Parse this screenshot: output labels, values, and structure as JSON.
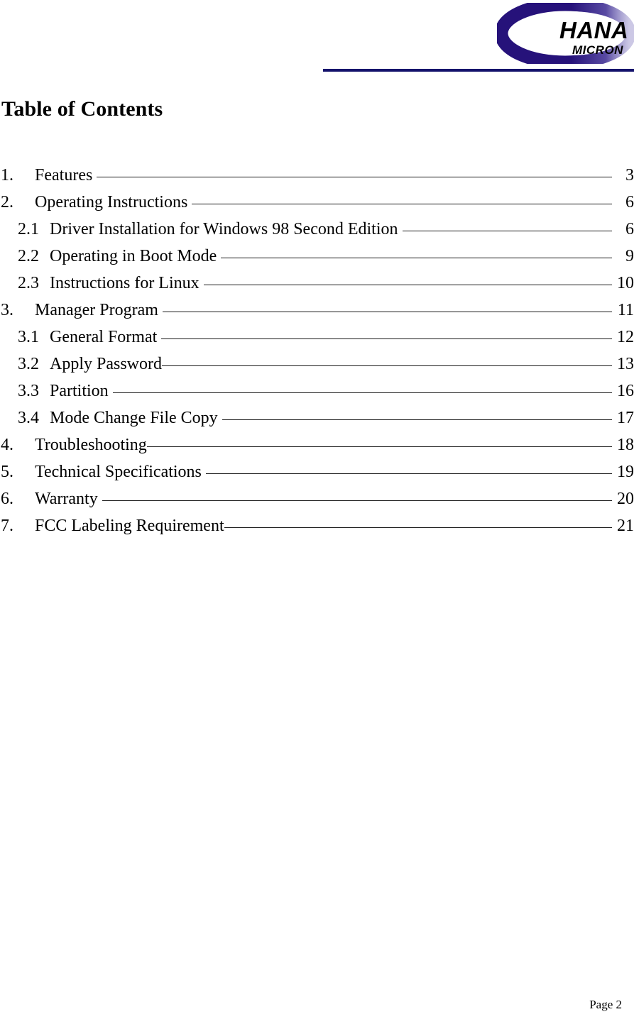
{
  "document": {
    "title": "Table of Contents"
  },
  "header": {
    "logo": {
      "name": "hana-micron-logo",
      "primary_text": "HANA",
      "secondary_text": "MICRON",
      "ring_color": "#26127a",
      "text_color": "#000000"
    },
    "rule_color": "#14126b"
  },
  "toc": {
    "entries": [
      {
        "number": "1.",
        "label": "Features",
        "page": "3",
        "level": 1,
        "space_before_leader": true
      },
      {
        "number": "2.",
        "label": "Operating Instructions",
        "page": "6",
        "level": 1,
        "space_before_leader": true
      },
      {
        "number": "2.1",
        "label": "Driver Installation for Windows 98 Second Edition",
        "page": "6",
        "level": 2,
        "space_before_leader": true
      },
      {
        "number": "2.2",
        "label": "Operating in Boot Mode",
        "page": "9",
        "level": 2,
        "space_before_leader": true
      },
      {
        "number": "2.3",
        "label": "Instructions for Linux",
        "page": "10",
        "level": 2,
        "space_before_leader": true
      },
      {
        "number": "3.",
        "label": "Manager Program",
        "page": "11",
        "level": 1,
        "space_before_leader": true
      },
      {
        "number": "3.1",
        "label": "General Format",
        "page": "12",
        "level": 2,
        "space_before_leader": true
      },
      {
        "number": "3.2",
        "label": "Apply Password",
        "page": "13",
        "level": 2,
        "space_before_leader": false
      },
      {
        "number": "3.3",
        "label": "Partition",
        "page": "16",
        "level": 2,
        "space_before_leader": true
      },
      {
        "number": "3.4",
        "label": "Mode Change File Copy",
        "page": "17",
        "level": 2,
        "space_before_leader": true
      },
      {
        "number": "4.",
        "label": "Troubleshooting",
        "page": "18",
        "level": 1,
        "space_before_leader": false
      },
      {
        "number": "5.",
        "label": "Technical Specifications",
        "page": "19",
        "level": 1,
        "space_before_leader": true
      },
      {
        "number": "6.",
        "label": "Warranty",
        "page": "20",
        "level": 1,
        "space_before_leader": true
      },
      {
        "number": "7.",
        "label": "FCC Labeling Requirement",
        "page": "21",
        "level": 1,
        "space_before_leader": false
      }
    ]
  },
  "footer": {
    "page_label": "Page 2"
  }
}
